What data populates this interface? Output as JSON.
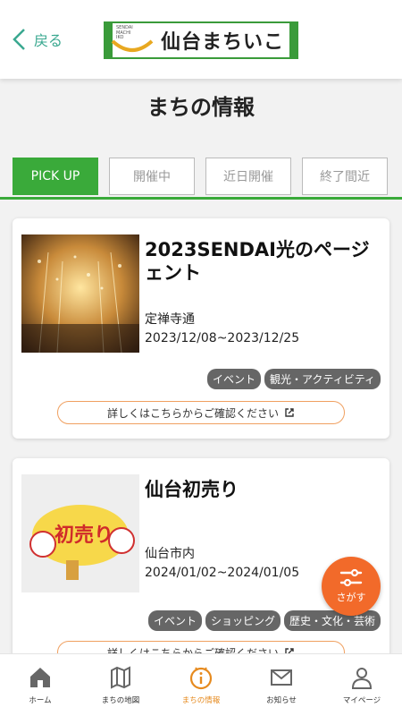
{
  "header": {
    "back_label": "戻る",
    "logo_small_text": "SENDAI\nMACHI\nIKO",
    "logo_text": "仙台まちいこ"
  },
  "page_title": "まちの情報",
  "tabs": [
    {
      "label": "PICK UP",
      "active": true
    },
    {
      "label": "開催中",
      "active": false
    },
    {
      "label": "近日開催",
      "active": false
    },
    {
      "label": "終了間近",
      "active": false
    }
  ],
  "cards": [
    {
      "title": "2023SENDAI光のページェント",
      "location": "定禅寺通",
      "date": "2023/12/08~2023/12/25",
      "tags": [
        "イベント",
        "観光・アクティビティ"
      ],
      "detail_label": "詳しくはこちらからご確認ください"
    },
    {
      "title": "仙台初売り",
      "location": "仙台市内",
      "date": "2024/01/02~2024/01/05",
      "tags": [
        "イベント",
        "ショッピング",
        "歴史・文化・芸術"
      ],
      "detail_label": "詳しくはこちらからご確認ください",
      "thumb_text": "初売り"
    }
  ],
  "fab": {
    "label": "さがす"
  },
  "bottom_nav": [
    {
      "label": "ホーム",
      "icon": "home-icon",
      "active": false
    },
    {
      "label": "まちの地図",
      "icon": "map-icon",
      "active": false
    },
    {
      "label": "まちの情報",
      "icon": "info-icon",
      "active": true
    },
    {
      "label": "お知らせ",
      "icon": "mail-icon",
      "active": false
    },
    {
      "label": "マイページ",
      "icon": "person-icon",
      "active": false
    }
  ],
  "colors": {
    "accent_green": "#3aaa3a",
    "accent_orange": "#f26a2a",
    "back_teal": "#3aa890"
  }
}
